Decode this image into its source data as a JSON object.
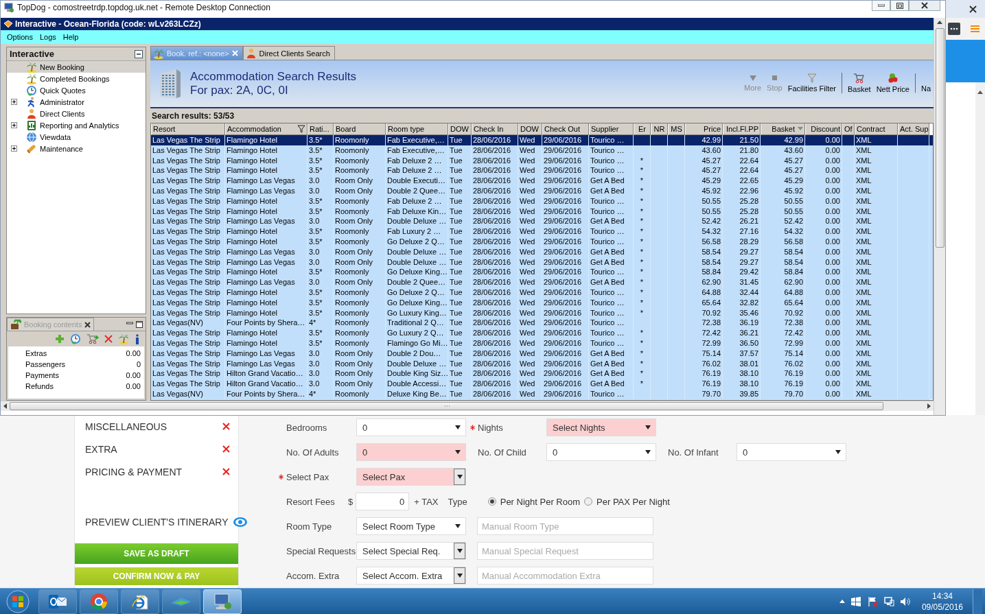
{
  "rdp_window": {
    "title": "TopDog - comostreetrdp.topdog.uk.net - Remote Desktop Connection"
  },
  "app": {
    "title": "Interactive - Ocean-Florida (code: wLv263LCZz)",
    "menu": [
      "Options",
      "Logs",
      "Help"
    ]
  },
  "sidebar": {
    "title": "Interactive",
    "items": [
      {
        "label": "New Booking",
        "selected": true,
        "has_children": false
      },
      {
        "label": "Completed Bookings",
        "selected": false,
        "has_children": false
      },
      {
        "label": "Quick Quotes",
        "selected": false,
        "has_children": false
      },
      {
        "label": "Administrator",
        "selected": false,
        "has_children": true
      },
      {
        "label": "Direct Clients",
        "selected": false,
        "has_children": false
      },
      {
        "label": "Reporting and Analytics",
        "selected": false,
        "has_children": true
      },
      {
        "label": "Viewdata",
        "selected": false,
        "has_children": false
      },
      {
        "label": "Maintenance",
        "selected": false,
        "has_children": true
      }
    ]
  },
  "booking_contents": {
    "title": "Booking contents",
    "rows": [
      {
        "label": "Extras",
        "value": "0.00"
      },
      {
        "label": "Passengers",
        "value": "0"
      },
      {
        "label": "Payments",
        "value": "0.00"
      },
      {
        "label": "Refunds",
        "value": "0.00"
      }
    ]
  },
  "tabs": [
    {
      "label": "Book. ref.: <none>",
      "selected": true,
      "closable": true
    },
    {
      "label": "Direct Clients Search",
      "selected": false,
      "closable": false
    }
  ],
  "results": {
    "title": "Accommodation Search Results",
    "subtitle": "For pax: 2A, 0C, 0I",
    "count": "Search results: 53/53"
  },
  "toolbar": [
    {
      "label": "More",
      "disabled": true,
      "separator_before": false
    },
    {
      "label": "Stop",
      "disabled": true,
      "separator_before": false
    },
    {
      "label": "Facilities Filter",
      "disabled": false,
      "separator_before": false
    },
    {
      "label": "Basket",
      "disabled": false,
      "separator_before": true
    },
    {
      "label": "Nett Price",
      "disabled": false,
      "separator_before": false
    },
    {
      "label": "Na",
      "disabled": false,
      "separator_before": true
    }
  ],
  "table": {
    "columns": [
      {
        "label": "Resort",
        "filtered": false,
        "sorted": false
      },
      {
        "label": "Accommodation",
        "filtered": true,
        "sorted": false
      },
      {
        "label": "Rati...",
        "filtered": false,
        "sorted": false
      },
      {
        "label": "Board",
        "filtered": false,
        "sorted": false
      },
      {
        "label": "Room type",
        "filtered": false,
        "sorted": false
      },
      {
        "label": "DOW",
        "filtered": false,
        "sorted": false
      },
      {
        "label": "Check In",
        "filtered": false,
        "sorted": false
      },
      {
        "label": "DOW",
        "filtered": false,
        "sorted": false
      },
      {
        "label": "Check Out",
        "filtered": false,
        "sorted": false
      },
      {
        "label": "Supplier",
        "filtered": false,
        "sorted": false
      },
      {
        "label": "Er",
        "filtered": false,
        "sorted": false
      },
      {
        "label": "NR",
        "filtered": false,
        "sorted": false
      },
      {
        "label": "MS",
        "filtered": false,
        "sorted": false
      },
      {
        "label": "Price",
        "filtered": false,
        "sorted": false
      },
      {
        "label": "Incl.Fl.PP",
        "filtered": false,
        "sorted": false
      },
      {
        "label": "Basket",
        "filtered": false,
        "sorted": true
      },
      {
        "label": "Discount",
        "filtered": false,
        "sorted": false
      },
      {
        "label": "Of",
        "filtered": false,
        "sorted": false
      },
      {
        "label": "Contract",
        "filtered": false,
        "sorted": false
      },
      {
        "label": "Act. Sup",
        "filtered": false,
        "sorted": false
      }
    ],
    "rows": [
      {
        "selected": true,
        "resort": "Las Vegas The Strip",
        "accommodation": "Flamingo Hotel",
        "rating": "3.5*",
        "board": "Roomonly",
        "room_type": "Fab Executive,…",
        "dow_in": "Tue",
        "check_in": "28/06/2016",
        "dow_out": "Wed",
        "check_out": "29/06/2016",
        "supplier": "Tourico …",
        "price": "42.99",
        "incl_fl_pp": "21.50",
        "basket": "42.99",
        "discount": "0.00",
        "contract": "XML"
      },
      {
        "selected": false,
        "resort": "Las Vegas The Strip",
        "accommodation": "Flamingo Hotel",
        "rating": "3.5*",
        "board": "Roomonly",
        "room_type": "Fab Executive,…",
        "dow_in": "Tue",
        "check_in": "28/06/2016",
        "dow_out": "Wed",
        "check_out": "29/06/2016",
        "supplier": "Tourico …",
        "price": "43.60",
        "incl_fl_pp": "21.80",
        "basket": "43.60",
        "discount": "0.00",
        "contract": "XML"
      },
      {
        "selected": false,
        "resort": "Las Vegas The Strip",
        "accommodation": "Flamingo Hotel",
        "rating": "3.5*",
        "board": "Roomonly",
        "room_type": "Fab Deluxe 2 …",
        "dow_in": "Tue",
        "check_in": "28/06/2016",
        "dow_out": "Wed",
        "check_out": "29/06/2016",
        "supplier": "Tourico …",
        "er": "*",
        "price": "45.27",
        "incl_fl_pp": "22.64",
        "basket": "45.27",
        "discount": "0.00",
        "contract": "XML"
      },
      {
        "selected": false,
        "resort": "Las Vegas The Strip",
        "accommodation": "Flamingo Hotel",
        "rating": "3.5*",
        "board": "Roomonly",
        "room_type": "Fab Deluxe 2 …",
        "dow_in": "Tue",
        "check_in": "28/06/2016",
        "dow_out": "Wed",
        "check_out": "29/06/2016",
        "supplier": "Tourico …",
        "er": "*",
        "price": "45.27",
        "incl_fl_pp": "22.64",
        "basket": "45.27",
        "discount": "0.00",
        "contract": "XML"
      },
      {
        "selected": false,
        "resort": "Las Vegas The Strip",
        "accommodation": "Flamingo Las Vegas",
        "rating": "3.0",
        "board": "Room Only",
        "room_type": "Double Executi…",
        "dow_in": "Tue",
        "check_in": "28/06/2016",
        "dow_out": "Wed",
        "check_out": "29/06/2016",
        "supplier": "Get A Bed",
        "er": "*",
        "price": "45.29",
        "incl_fl_pp": "22.65",
        "basket": "45.29",
        "discount": "0.00",
        "contract": "XML"
      },
      {
        "selected": false,
        "resort": "Las Vegas The Strip",
        "accommodation": "Flamingo Las Vegas",
        "rating": "3.0",
        "board": "Room Only",
        "room_type": "Double 2 Quee…",
        "dow_in": "Tue",
        "check_in": "28/06/2016",
        "dow_out": "Wed",
        "check_out": "29/06/2016",
        "supplier": "Get A Bed",
        "er": "*",
        "price": "45.92",
        "incl_fl_pp": "22.96",
        "basket": "45.92",
        "discount": "0.00",
        "contract": "XML"
      },
      {
        "selected": false,
        "resort": "Las Vegas The Strip",
        "accommodation": "Flamingo Hotel",
        "rating": "3.5*",
        "board": "Roomonly",
        "room_type": "Fab Deluxe 2 …",
        "dow_in": "Tue",
        "check_in": "28/06/2016",
        "dow_out": "Wed",
        "check_out": "29/06/2016",
        "supplier": "Tourico …",
        "er": "*",
        "price": "50.55",
        "incl_fl_pp": "25.28",
        "basket": "50.55",
        "discount": "0.00",
        "contract": "XML"
      },
      {
        "selected": false,
        "resort": "Las Vegas The Strip",
        "accommodation": "Flamingo Hotel",
        "rating": "3.5*",
        "board": "Roomonly",
        "room_type": "Fab Deluxe Kin…",
        "dow_in": "Tue",
        "check_in": "28/06/2016",
        "dow_out": "Wed",
        "check_out": "29/06/2016",
        "supplier": "Tourico …",
        "er": "*",
        "price": "50.55",
        "incl_fl_pp": "25.28",
        "basket": "50.55",
        "discount": "0.00",
        "contract": "XML"
      },
      {
        "selected": false,
        "resort": "Las Vegas The Strip",
        "accommodation": "Flamingo Las Vegas",
        "rating": "3.0",
        "board": "Room Only",
        "room_type": "Double Deluxe …",
        "dow_in": "Tue",
        "check_in": "28/06/2016",
        "dow_out": "Wed",
        "check_out": "29/06/2016",
        "supplier": "Get A Bed",
        "er": "*",
        "price": "52.42",
        "incl_fl_pp": "26.21",
        "basket": "52.42",
        "discount": "0.00",
        "contract": "XML"
      },
      {
        "selected": false,
        "resort": "Las Vegas The Strip",
        "accommodation": "Flamingo Hotel",
        "rating": "3.5*",
        "board": "Roomonly",
        "room_type": "Fab Luxury 2 …",
        "dow_in": "Tue",
        "check_in": "28/06/2016",
        "dow_out": "Wed",
        "check_out": "29/06/2016",
        "supplier": "Tourico …",
        "er": "*",
        "price": "54.32",
        "incl_fl_pp": "27.16",
        "basket": "54.32",
        "discount": "0.00",
        "contract": "XML"
      },
      {
        "selected": false,
        "resort": "Las Vegas The Strip",
        "accommodation": "Flamingo Hotel",
        "rating": "3.5*",
        "board": "Roomonly",
        "room_type": "Go Deluxe 2 Q…",
        "dow_in": "Tue",
        "check_in": "28/06/2016",
        "dow_out": "Wed",
        "check_out": "29/06/2016",
        "supplier": "Tourico …",
        "er": "*",
        "price": "56.58",
        "incl_fl_pp": "28.29",
        "basket": "56.58",
        "discount": "0.00",
        "contract": "XML"
      },
      {
        "selected": false,
        "resort": "Las Vegas The Strip",
        "accommodation": "Flamingo Las Vegas",
        "rating": "3.0",
        "board": "Room Only",
        "room_type": "Double Deluxe …",
        "dow_in": "Tue",
        "check_in": "28/06/2016",
        "dow_out": "Wed",
        "check_out": "29/06/2016",
        "supplier": "Get A Bed",
        "er": "*",
        "price": "58.54",
        "incl_fl_pp": "29.27",
        "basket": "58.54",
        "discount": "0.00",
        "contract": "XML"
      },
      {
        "selected": false,
        "resort": "Las Vegas The Strip",
        "accommodation": "Flamingo Las Vegas",
        "rating": "3.0",
        "board": "Room Only",
        "room_type": "Double Deluxe …",
        "dow_in": "Tue",
        "check_in": "28/06/2016",
        "dow_out": "Wed",
        "check_out": "29/06/2016",
        "supplier": "Get A Bed",
        "er": "*",
        "price": "58.54",
        "incl_fl_pp": "29.27",
        "basket": "58.54",
        "discount": "0.00",
        "contract": "XML"
      },
      {
        "selected": false,
        "resort": "Las Vegas The Strip",
        "accommodation": "Flamingo Hotel",
        "rating": "3.5*",
        "board": "Roomonly",
        "room_type": "Go Deluxe King…",
        "dow_in": "Tue",
        "check_in": "28/06/2016",
        "dow_out": "Wed",
        "check_out": "29/06/2016",
        "supplier": "Tourico …",
        "er": "*",
        "price": "58.84",
        "incl_fl_pp": "29.42",
        "basket": "58.84",
        "discount": "0.00",
        "contract": "XML"
      },
      {
        "selected": false,
        "resort": "Las Vegas The Strip",
        "accommodation": "Flamingo Las Vegas",
        "rating": "3.0",
        "board": "Room Only",
        "room_type": "Double 2 Quee…",
        "dow_in": "Tue",
        "check_in": "28/06/2016",
        "dow_out": "Wed",
        "check_out": "29/06/2016",
        "supplier": "Get A Bed",
        "er": "*",
        "price": "62.90",
        "incl_fl_pp": "31.45",
        "basket": "62.90",
        "discount": "0.00",
        "contract": "XML"
      },
      {
        "selected": false,
        "resort": "Las Vegas The Strip",
        "accommodation": "Flamingo Hotel",
        "rating": "3.5*",
        "board": "Roomonly",
        "room_type": "Go Deluxe 2 Q…",
        "dow_in": "Tue",
        "check_in": "28/06/2016",
        "dow_out": "Wed",
        "check_out": "29/06/2016",
        "supplier": "Tourico …",
        "er": "*",
        "price": "64.88",
        "incl_fl_pp": "32.44",
        "basket": "64.88",
        "discount": "0.00",
        "contract": "XML"
      },
      {
        "selected": false,
        "resort": "Las Vegas The Strip",
        "accommodation": "Flamingo Hotel",
        "rating": "3.5*",
        "board": "Roomonly",
        "room_type": "Go Deluxe King…",
        "dow_in": "Tue",
        "check_in": "28/06/2016",
        "dow_out": "Wed",
        "check_out": "29/06/2016",
        "supplier": "Tourico …",
        "er": "*",
        "price": "65.64",
        "incl_fl_pp": "32.82",
        "basket": "65.64",
        "discount": "0.00",
        "contract": "XML"
      },
      {
        "selected": false,
        "resort": "Las Vegas The Strip",
        "accommodation": "Flamingo Hotel",
        "rating": "3.5*",
        "board": "Roomonly",
        "room_type": "Go Luxury King…",
        "dow_in": "Tue",
        "check_in": "28/06/2016",
        "dow_out": "Wed",
        "check_out": "29/06/2016",
        "supplier": "Tourico …",
        "er": "*",
        "price": "70.92",
        "incl_fl_pp": "35.46",
        "basket": "70.92",
        "discount": "0.00",
        "contract": "XML"
      },
      {
        "selected": false,
        "resort": "Las Vegas(NV)",
        "accommodation": "Four Points by Shera…",
        "rating": "4*",
        "board": "Roomonly",
        "room_type": "Traditional 2 Q…",
        "dow_in": "Tue",
        "check_in": "28/06/2016",
        "dow_out": "Wed",
        "check_out": "29/06/2016",
        "supplier": "Tourico …",
        "price": "72.38",
        "incl_fl_pp": "36.19",
        "basket": "72.38",
        "discount": "0.00",
        "contract": "XML"
      },
      {
        "selected": false,
        "resort": "Las Vegas The Strip",
        "accommodation": "Flamingo Hotel",
        "rating": "3.5*",
        "board": "Roomonly",
        "room_type": "Go Luxury 2 Q…",
        "dow_in": "Tue",
        "check_in": "28/06/2016",
        "dow_out": "Wed",
        "check_out": "29/06/2016",
        "supplier": "Tourico …",
        "er": "*",
        "price": "72.42",
        "incl_fl_pp": "36.21",
        "basket": "72.42",
        "discount": "0.00",
        "contract": "XML"
      },
      {
        "selected": false,
        "resort": "Las Vegas The Strip",
        "accommodation": "Flamingo Hotel",
        "rating": "3.5*",
        "board": "Roomonly",
        "room_type": "Flamingo Go Mi…",
        "dow_in": "Tue",
        "check_in": "28/06/2016",
        "dow_out": "Wed",
        "check_out": "29/06/2016",
        "supplier": "Tourico …",
        "er": "*",
        "price": "72.99",
        "incl_fl_pp": "36.50",
        "basket": "72.99",
        "discount": "0.00",
        "contract": "XML"
      },
      {
        "selected": false,
        "resort": "Las Vegas The Strip",
        "accommodation": "Flamingo Las Vegas",
        "rating": "3.0",
        "board": "Room Only",
        "room_type": "Double 2  Dou…",
        "dow_in": "Tue",
        "check_in": "28/06/2016",
        "dow_out": "Wed",
        "check_out": "29/06/2016",
        "supplier": "Get A Bed",
        "er": "*",
        "price": "75.14",
        "incl_fl_pp": "37.57",
        "basket": "75.14",
        "discount": "0.00",
        "contract": "XML"
      },
      {
        "selected": false,
        "resort": "Las Vegas The Strip",
        "accommodation": "Flamingo Las Vegas",
        "rating": "3.0",
        "board": "Room Only",
        "room_type": "Double Deluxe …",
        "dow_in": "Tue",
        "check_in": "28/06/2016",
        "dow_out": "Wed",
        "check_out": "29/06/2016",
        "supplier": "Get A Bed",
        "er": "*",
        "price": "76.02",
        "incl_fl_pp": "38.01",
        "basket": "76.02",
        "discount": "0.00",
        "contract": "XML"
      },
      {
        "selected": false,
        "resort": "Las Vegas The Strip",
        "accommodation": "Hilton Grand Vacatio…",
        "rating": "3.0",
        "board": "Room Only",
        "room_type": "Double King Siz…",
        "dow_in": "Tue",
        "check_in": "28/06/2016",
        "dow_out": "Wed",
        "check_out": "29/06/2016",
        "supplier": "Get A Bed",
        "er": "*",
        "price": "76.19",
        "incl_fl_pp": "38.10",
        "basket": "76.19",
        "discount": "0.00",
        "contract": "XML"
      },
      {
        "selected": false,
        "resort": "Las Vegas The Strip",
        "accommodation": "Hilton Grand Vacatio…",
        "rating": "3.0",
        "board": "Room Only",
        "room_type": "Double Accessi…",
        "dow_in": "Tue",
        "check_in": "28/06/2016",
        "dow_out": "Wed",
        "check_out": "29/06/2016",
        "supplier": "Get A Bed",
        "er": "*",
        "price": "76.19",
        "incl_fl_pp": "38.10",
        "basket": "76.19",
        "discount": "0.00",
        "contract": "XML"
      },
      {
        "selected": false,
        "resort": "Las Vegas(NV)",
        "accommodation": "Four Points by Shera…",
        "rating": "4*",
        "board": "Roomonly",
        "room_type": "Deluxe King Be…",
        "dow_in": "Tue",
        "check_in": "28/06/2016",
        "dow_out": "Wed",
        "check_out": "29/06/2016",
        "supplier": "Tourico …",
        "price": "79.70",
        "incl_fl_pp": "39.85",
        "basket": "79.70",
        "discount": "0.00",
        "contract": "XML"
      }
    ]
  },
  "web_page": {
    "nav": {
      "sections": [
        {
          "label": "MISCELLANEOUS",
          "complete": false
        },
        {
          "label": "EXTRA",
          "complete": false
        },
        {
          "label": "PRICING & PAYMENT",
          "complete": false
        }
      ],
      "preview": "PREVIEW CLIENT'S ITINERARY",
      "buttons": [
        {
          "label": "SAVE AS DRAFT",
          "kind": "draft"
        },
        {
          "label": "CONFIRM NOW & PAY",
          "kind": "confirm"
        }
      ]
    },
    "form": [
      {
        "fields": [
          {
            "kind": "select",
            "label": "Bedrooms",
            "required": false,
            "value": "0",
            "invalid": false
          },
          {
            "kind": "select",
            "label": "Nights",
            "required": true,
            "value": "Select Nights",
            "invalid": true
          }
        ]
      },
      {
        "fields": [
          {
            "kind": "select",
            "label": "No. Of Adults",
            "required": false,
            "value": "0",
            "invalid": true
          },
          {
            "kind": "select",
            "label": "No. Of Child",
            "required": false,
            "value": "0",
            "invalid": false
          },
          {
            "kind": "select",
            "label": "No. Of Infant",
            "required": false,
            "value": "0",
            "invalid": false
          }
        ]
      },
      {
        "fields": [
          {
            "kind": "combo",
            "label": "Select Pax",
            "required": true,
            "value": "Select Pax",
            "invalid": true
          }
        ]
      },
      {
        "fields": [
          {
            "kind": "money",
            "label": "Resort Fees",
            "required": false,
            "currency": "$",
            "value": "0",
            "suffix": "+ TAX"
          },
          {
            "kind": "radio_group",
            "label": "Type",
            "options": [
              {
                "label": "Per Night Per Room",
                "selected": true
              },
              {
                "label": "Per PAX Per Night",
                "selected": false
              }
            ]
          }
        ]
      },
      {
        "fields": [
          {
            "kind": "select",
            "label": "Room Type",
            "required": false,
            "value": "Select Room Type",
            "invalid": false
          },
          {
            "kind": "text",
            "placeholder": "Manual Room Type"
          }
        ]
      },
      {
        "fields": [
          {
            "kind": "combo",
            "label": "Special Requests",
            "required": false,
            "value": "Select Special Req.",
            "invalid": false
          },
          {
            "kind": "text",
            "placeholder": "Manual Special Request"
          }
        ]
      },
      {
        "fields": [
          {
            "kind": "combo",
            "label": "Accom. Extra",
            "required": false,
            "value": "Select Accom. Extra",
            "invalid": false
          },
          {
            "kind": "text",
            "placeholder": "Manual Accommodation Extra"
          }
        ]
      }
    ]
  },
  "taskbar": {
    "apps": [
      {
        "selected": false
      },
      {
        "selected": false
      },
      {
        "selected": false
      },
      {
        "selected": false
      },
      {
        "selected": true
      }
    ],
    "time": "14:34",
    "date": "09/05/2016"
  }
}
